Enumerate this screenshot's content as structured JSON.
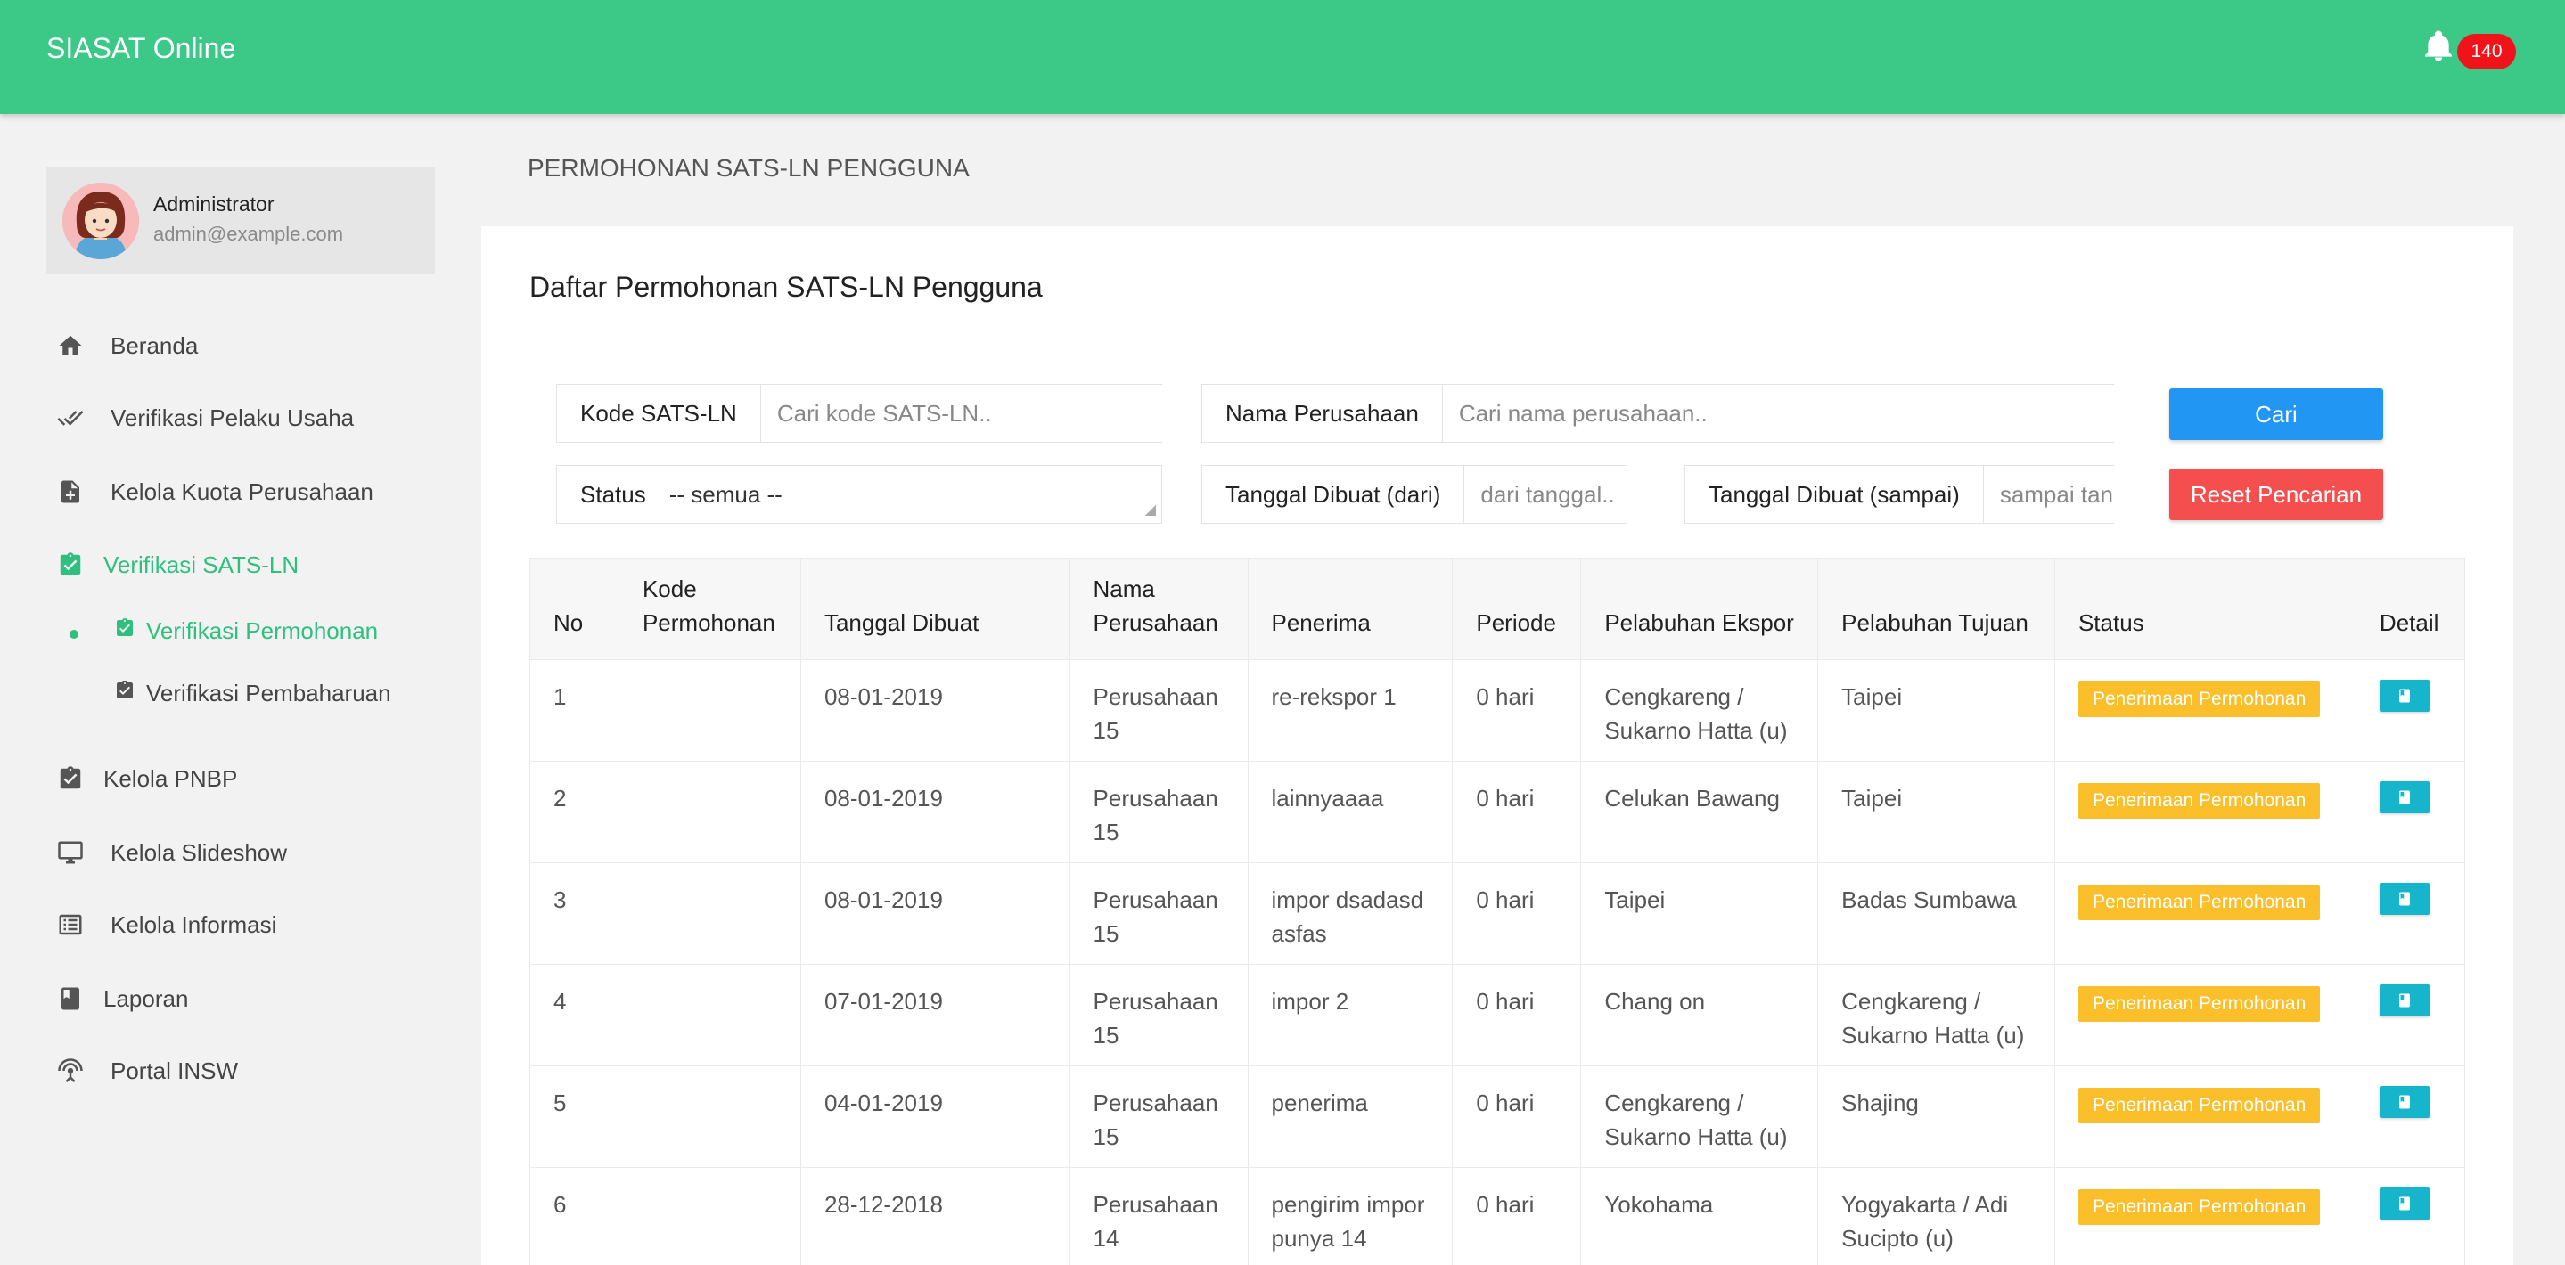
{
  "app": {
    "title": "SIASAT Online",
    "notification_count": "140"
  },
  "user": {
    "name": "Administrator",
    "email": "admin@example.com"
  },
  "sidebar": {
    "items": [
      {
        "label": "Beranda",
        "icon": "home-icon"
      },
      {
        "label": "Verifikasi Pelaku Usaha",
        "icon": "double-check-icon"
      },
      {
        "label": "Kelola Kuota Perusahaan",
        "icon": "file-plus-icon"
      },
      {
        "label": "Verifikasi SATS-LN",
        "icon": "clipboard-check-icon",
        "active": true
      },
      {
        "label": "Kelola PNBP",
        "icon": "clipboard-check-icon"
      },
      {
        "label": "Kelola Slideshow",
        "icon": "monitor-icon"
      },
      {
        "label": "Kelola Informasi",
        "icon": "list-icon"
      },
      {
        "label": "Laporan",
        "icon": "book-icon"
      },
      {
        "label": "Portal INSW",
        "icon": "antenna-icon"
      }
    ],
    "subitems": [
      {
        "label": "Verifikasi Permohonan",
        "active": true
      },
      {
        "label": "Verifikasi Pembaharuan"
      }
    ]
  },
  "page": {
    "heading": "PERMOHONAN SATS-LN PENGGUNA",
    "card_title": "Daftar Permohonan SATS-LN Pengguna"
  },
  "filters": {
    "kode_label": "Kode SATS-LN",
    "kode_placeholder": "Cari kode SATS-LN..",
    "nama_label": "Nama Perusahaan",
    "nama_placeholder": "Cari nama perusahaan..",
    "status_label": "Status",
    "status_value": "-- semua --",
    "dari_label": "Tanggal Dibuat (dari)",
    "dari_placeholder": "dari tanggal..",
    "sampai_label": "Tanggal Dibuat (sampai)",
    "sampai_placeholder": "sampai tanggal..",
    "search_button": "Cari",
    "reset_button": "Reset Pencarian"
  },
  "table": {
    "headers": [
      "No",
      "Kode Permohonan",
      "Tanggal Dibuat",
      "Nama Perusahaan",
      "Penerima",
      "Periode",
      "Pelabuhan Ekspor",
      "Pelabuhan Tujuan",
      "Status",
      "Detail"
    ],
    "rows": [
      {
        "no": "1",
        "kode": "",
        "tanggal": "08-01-2019",
        "perusahaan": "Perusahaan 15",
        "penerima": "re-rekspor 1",
        "periode": "0 hari",
        "ekspor": "Cengkareng / Sukarno Hatta (u)",
        "tujuan": "Taipei",
        "status": "Penerimaan Permohonan"
      },
      {
        "no": "2",
        "kode": "",
        "tanggal": "08-01-2019",
        "perusahaan": "Perusahaan 15",
        "penerima": "lainnyaaaa",
        "periode": "0 hari",
        "ekspor": "Celukan Bawang",
        "tujuan": "Taipei",
        "status": "Penerimaan Permohonan"
      },
      {
        "no": "3",
        "kode": "",
        "tanggal": "08-01-2019",
        "perusahaan": "Perusahaan 15",
        "penerima": "impor dsadasd asfas",
        "periode": "0 hari",
        "ekspor": "Taipei",
        "tujuan": "Badas Sumbawa",
        "status": "Penerimaan Permohonan"
      },
      {
        "no": "4",
        "kode": "",
        "tanggal": "07-01-2019",
        "perusahaan": "Perusahaan 15",
        "penerima": "impor 2",
        "periode": "0 hari",
        "ekspor": "Chang on",
        "tujuan": "Cengkareng / Sukarno Hatta (u)",
        "status": "Penerimaan Permohonan"
      },
      {
        "no": "5",
        "kode": "",
        "tanggal": "04-01-2019",
        "perusahaan": "Perusahaan 15",
        "penerima": "penerima",
        "periode": "0 hari",
        "ekspor": "Cengkareng / Sukarno Hatta (u)",
        "tujuan": "Shajing",
        "status": "Penerimaan Permohonan"
      },
      {
        "no": "6",
        "kode": "",
        "tanggal": "28-12-2018",
        "perusahaan": "Perusahaan 14",
        "penerima": "pengirim impor punya 14",
        "periode": "0 hari",
        "ekspor": "Yokohama",
        "tujuan": "Yogyakarta / Adi Sucipto (u)",
        "status": "Penerimaan Permohonan"
      }
    ]
  },
  "colors": {
    "primary": "#3cc887",
    "accent_green": "#2fbf7e",
    "badge_red": "#f0131a",
    "status_yellow": "#fbbf2b",
    "detail_cyan": "#17b5cc",
    "button_blue": "#2196f3",
    "button_red": "#f44e4e"
  }
}
